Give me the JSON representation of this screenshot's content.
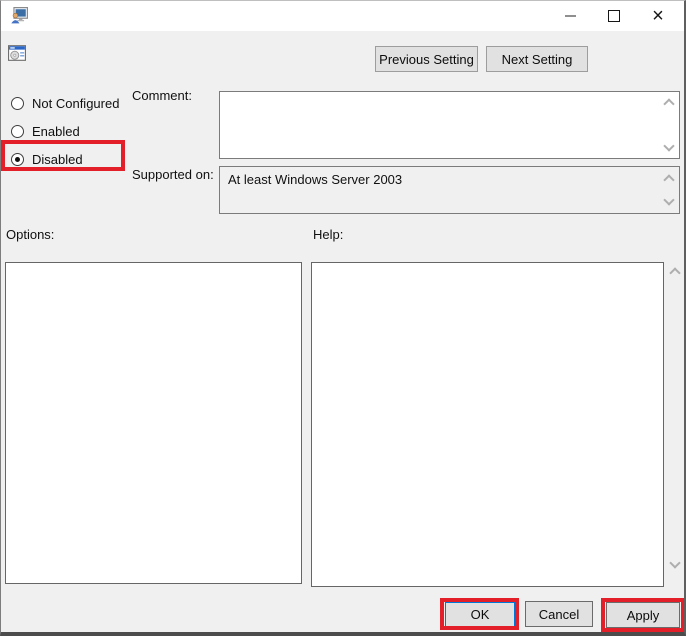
{
  "window": {
    "title": "",
    "controls": {
      "close_glyph": "×"
    }
  },
  "header": {
    "previous_button": "Previous Setting",
    "next_button": "Next Setting"
  },
  "radio_group": {
    "options": [
      {
        "label": "Not Configured",
        "selected": false
      },
      {
        "label": "Enabled",
        "selected": false
      },
      {
        "label": "Disabled",
        "selected": true
      }
    ]
  },
  "comment": {
    "label": "Comment:",
    "value": ""
  },
  "supported_on": {
    "label": "Supported on:",
    "value": "At least Windows Server 2003"
  },
  "options_panel": {
    "label": "Options:",
    "content": ""
  },
  "help_panel": {
    "label": "Help:",
    "content": ""
  },
  "footer": {
    "ok": "OK",
    "cancel": "Cancel",
    "apply": "Apply"
  },
  "colors": {
    "annotation_red": "#e3202a",
    "default_button_accent": "#0078d7",
    "dialog_background": "#f0f0f0",
    "titlebar_background": "#ffffff",
    "button_face": "#e1e1e1"
  }
}
